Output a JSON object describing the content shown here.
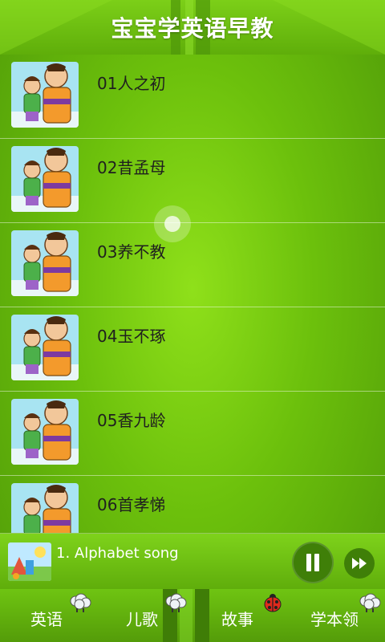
{
  "header": {
    "title": "宝宝学英语早教"
  },
  "list": {
    "items": [
      {
        "label": "01人之初"
      },
      {
        "label": "02昔孟母"
      },
      {
        "label": "03养不教"
      },
      {
        "label": "04玉不琢"
      },
      {
        "label": "05香九龄"
      },
      {
        "label": "06首孝悌"
      }
    ]
  },
  "player": {
    "track_title": "1. Alphabet song",
    "pause_icon": "pause-icon",
    "next_icon": "fast-forward-icon"
  },
  "tabs": [
    {
      "label": "英语",
      "icon": "sheep-icon"
    },
    {
      "label": "儿歌",
      "icon": "sheep-icon"
    },
    {
      "label": "故事",
      "icon": "ladybug-icon"
    },
    {
      "label": "学本领",
      "icon": "sheep-icon"
    }
  ],
  "colors": {
    "accent": "#6cc00c",
    "dark_green": "#3f7f08",
    "title_text": "#ffffff"
  }
}
